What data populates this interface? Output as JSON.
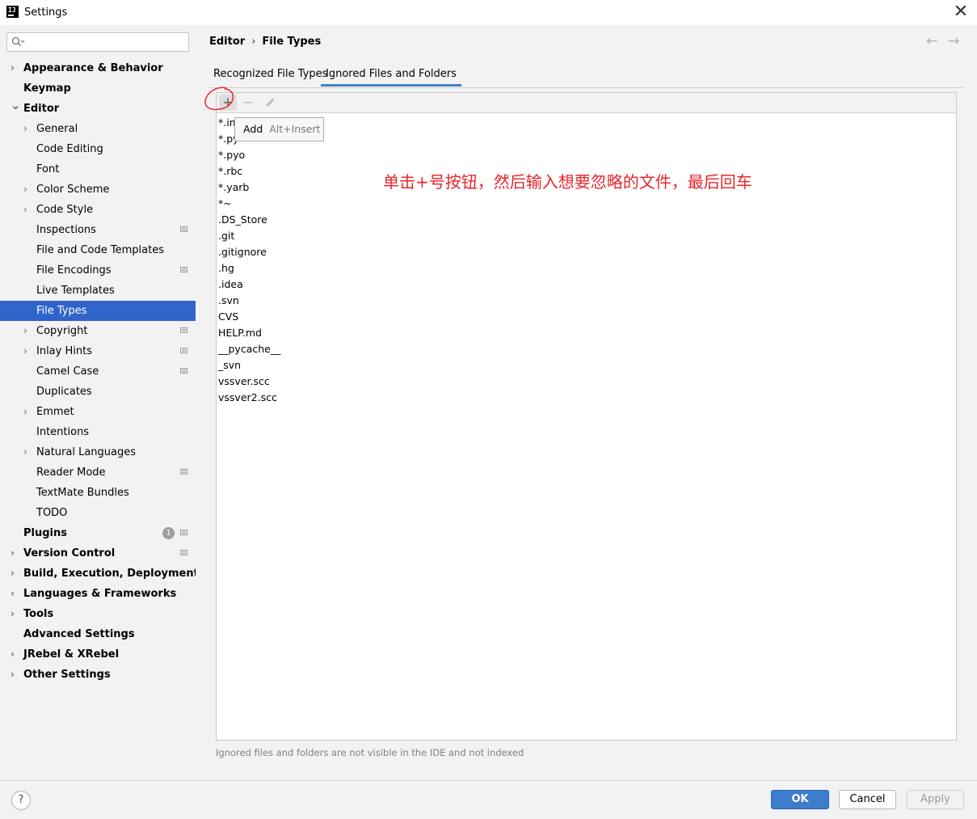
{
  "window": {
    "title": "Settings",
    "logo_text": "IJ",
    "close_label": "✕"
  },
  "search": {
    "placeholder": "",
    "value": ""
  },
  "sidebar": {
    "items": [
      {
        "label": "Appearance & Behavior",
        "level": 0,
        "expandable": true,
        "expanded": false
      },
      {
        "label": "Keymap",
        "level": 0,
        "expandable": false
      },
      {
        "label": "Editor",
        "level": 0,
        "expandable": true,
        "expanded": true
      },
      {
        "label": "General",
        "level": 1,
        "expandable": true,
        "expanded": false
      },
      {
        "label": "Code Editing",
        "level": 1,
        "expandable": false
      },
      {
        "label": "Font",
        "level": 1,
        "expandable": false
      },
      {
        "label": "Color Scheme",
        "level": 1,
        "expandable": true,
        "expanded": false
      },
      {
        "label": "Code Style",
        "level": 1,
        "expandable": true,
        "expanded": false
      },
      {
        "label": "Inspections",
        "level": 1,
        "expandable": false,
        "project": true
      },
      {
        "label": "File and Code Templates",
        "level": 1,
        "expandable": false
      },
      {
        "label": "File Encodings",
        "level": 1,
        "expandable": false,
        "project": true
      },
      {
        "label": "Live Templates",
        "level": 1,
        "expandable": false
      },
      {
        "label": "File Types",
        "level": 1,
        "expandable": false,
        "selected": true
      },
      {
        "label": "Copyright",
        "level": 1,
        "expandable": true,
        "expanded": false,
        "project": true
      },
      {
        "label": "Inlay Hints",
        "level": 1,
        "expandable": true,
        "expanded": false,
        "project": true
      },
      {
        "label": "Camel Case",
        "level": 1,
        "expandable": false,
        "project": true
      },
      {
        "label": "Duplicates",
        "level": 1,
        "expandable": false
      },
      {
        "label": "Emmet",
        "level": 1,
        "expandable": true,
        "expanded": false
      },
      {
        "label": "Intentions",
        "level": 1,
        "expandable": false
      },
      {
        "label": "Natural Languages",
        "level": 1,
        "expandable": true,
        "expanded": false
      },
      {
        "label": "Reader Mode",
        "level": 1,
        "expandable": false,
        "project": true
      },
      {
        "label": "TextMate Bundles",
        "level": 1,
        "expandable": false
      },
      {
        "label": "TODO",
        "level": 1,
        "expandable": false
      },
      {
        "label": "Plugins",
        "level": 0,
        "expandable": false,
        "project": true,
        "badge": "1"
      },
      {
        "label": "Version Control",
        "level": 0,
        "expandable": true,
        "expanded": false,
        "project": true
      },
      {
        "label": "Build, Execution, Deployment",
        "level": 0,
        "expandable": true,
        "expanded": false
      },
      {
        "label": "Languages & Frameworks",
        "level": 0,
        "expandable": true,
        "expanded": false
      },
      {
        "label": "Tools",
        "level": 0,
        "expandable": true,
        "expanded": false
      },
      {
        "label": "Advanced Settings",
        "level": 0,
        "expandable": false
      },
      {
        "label": "JRebel & XRebel",
        "level": 0,
        "expandable": true,
        "expanded": false
      },
      {
        "label": "Other Settings",
        "level": 0,
        "expandable": true,
        "expanded": false
      }
    ]
  },
  "breadcrumb": {
    "parent": "Editor",
    "separator": "›",
    "current": "File Types"
  },
  "nav": {
    "back": "←",
    "forward": "→"
  },
  "tabs": [
    {
      "label": "Recognized File Types",
      "active": false
    },
    {
      "label": "Ignored Files and Folders",
      "active": true
    }
  ],
  "toolbar": {
    "add": "+",
    "remove": "−"
  },
  "ignored_list": [
    "*.im",
    "*.py",
    "*.pyo",
    "*.rbc",
    "*.yarb",
    "*~",
    ".DS_Store",
    ".git",
    ".gitignore",
    ".hg",
    ".idea",
    ".svn",
    "CVS",
    "HELP.md",
    "__pycache__",
    "_svn",
    "vssver.scc",
    "vssver2.scc"
  ],
  "tooltip": {
    "label": "Add",
    "shortcut": "Alt+Insert"
  },
  "annotation": "单击+号按钮，然后输入想要忽略的文件，最后回车",
  "footnote": "Ignored files and folders are not visible in the IDE and not indexed",
  "footer": {
    "help": "?",
    "ok": "OK",
    "cancel": "Cancel",
    "apply": "Apply"
  },
  "colors": {
    "selection": "#2f65ca",
    "ok_button": "#3d7ccc",
    "annotation": "#e8262a",
    "tab_underline": "#4083c9"
  }
}
